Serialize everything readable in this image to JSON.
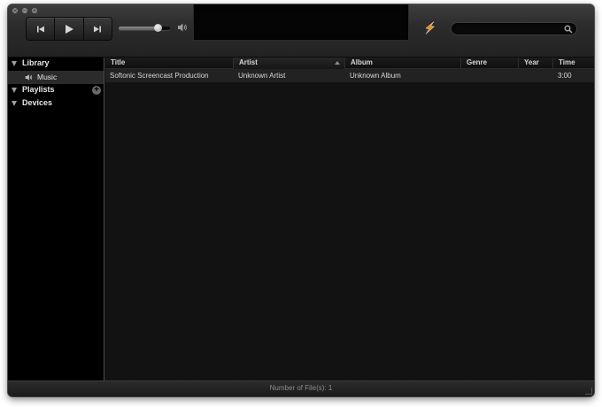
{
  "titlebar": {
    "close_glyph": "×",
    "minimize_glyph": "−",
    "zoom_glyph": "+"
  },
  "transport": {
    "prev_icon": "skip-back-icon",
    "play_icon": "play-icon",
    "next_icon": "skip-forward-icon"
  },
  "volume": {
    "level": 0.75,
    "icon": "speaker-icon"
  },
  "search": {
    "value": "",
    "placeholder": ""
  },
  "sidebar": {
    "sections": [
      {
        "label": "Library",
        "expanded": true
      },
      {
        "label": "Playlists",
        "expanded": true
      },
      {
        "label": "Devices",
        "expanded": true
      }
    ],
    "library_items": [
      {
        "label": "Music",
        "icon": "speaker-icon",
        "selected": true
      }
    ]
  },
  "table": {
    "columns": [
      "Title",
      "Artist",
      "Album",
      "Genre",
      "Year",
      "Time"
    ],
    "sorted_column": "Artist",
    "sort_direction": "ascending",
    "rows": [
      {
        "title": "Softonic Screencast Production",
        "artist": "Unknown Artist",
        "album": "Unknown Album",
        "genre": "",
        "year": "",
        "time": "3:00"
      }
    ]
  },
  "status": {
    "text": "Number of File(s): 1"
  },
  "colors": {
    "window_bg": "#131313",
    "sidebar_bg": "#000000",
    "selected_row": "#222222",
    "accent_orange": "#f0891e"
  }
}
